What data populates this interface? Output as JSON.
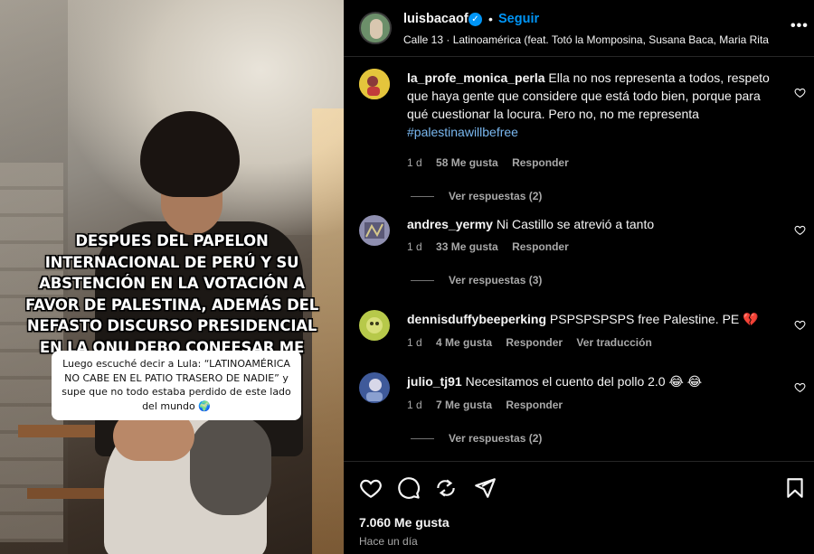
{
  "post": {
    "caption_main": "DESPUES DEL PAPELON INTERNACIONAL DE PERÚ Y SU ABSTENCIÓN EN LA VOTACIÓN A FAVOR DE PALESTINA, ADEMÁS DEL NEFASTO DISCURSO PRESIDENCIAL EN LA ONU DEBO CONFESAR ME SENTÍA SIN ESPERANZA..",
    "caption_box": "Luego escuché decir a Lula: “LATINOAMÉRICA NO CABE EN EL PATIO TRASERO DE NADIE” y supe que no todo estaba perdido de este lado del mundo 🌍"
  },
  "header": {
    "username": "luisbacaof",
    "dot": "•",
    "follow_label": "Seguir",
    "audio": "Calle 13 · Latinoamérica (feat. Totó la Momposina, Susana Baca, Maria Rita)",
    "more": "•••",
    "verified_glyph": "✓"
  },
  "comments": [
    {
      "user": "la_profe_monica_perla",
      "text": "Ella no nos representa a todos, respeto que haya gente que considere que está todo bien, porque para qué cuestionar la locura. Pero no, no me representa",
      "tag": "#palestinawillbefree",
      "time": "1 d",
      "likes": "58 Me gusta",
      "reply": "Responder",
      "view_replies": "Ver respuestas (2)",
      "avatar_color": "#e4c53c"
    },
    {
      "user": "andres_yermy",
      "text": "Ni Castillo se atrevió a tanto",
      "time": "1 d",
      "likes": "33 Me gusta",
      "reply": "Responder",
      "view_replies": "Ver respuestas (3)",
      "avatar_color": "#7b7fa6"
    },
    {
      "user": "dennisduffybeeperking",
      "text": "PSPSPSPSPS free Palestine. PE 💔",
      "time": "1 d",
      "likes": "4 Me gusta",
      "reply": "Responder",
      "translate": "Ver traducción",
      "avatar_color": "#b7c94a"
    },
    {
      "user": "julio_tj91",
      "text": "Necesitamos el cuento del pollo 2.0 😂 😂",
      "time": "1 d",
      "likes": "7 Me gusta",
      "reply": "Responder",
      "view_replies": "Ver respuestas (2)",
      "avatar_color": "#5a6fae"
    }
  ],
  "footer": {
    "likes": "7.060 Me gusta",
    "time": "Hace un día"
  },
  "colors": {
    "accent": "#0095f6",
    "background": "#000000",
    "secondary_text": "#a8a8a8"
  },
  "icons": [
    "heart-icon",
    "comment-icon",
    "share-icon",
    "send-icon",
    "bookmark-icon",
    "verified-icon",
    "more-icon"
  ]
}
